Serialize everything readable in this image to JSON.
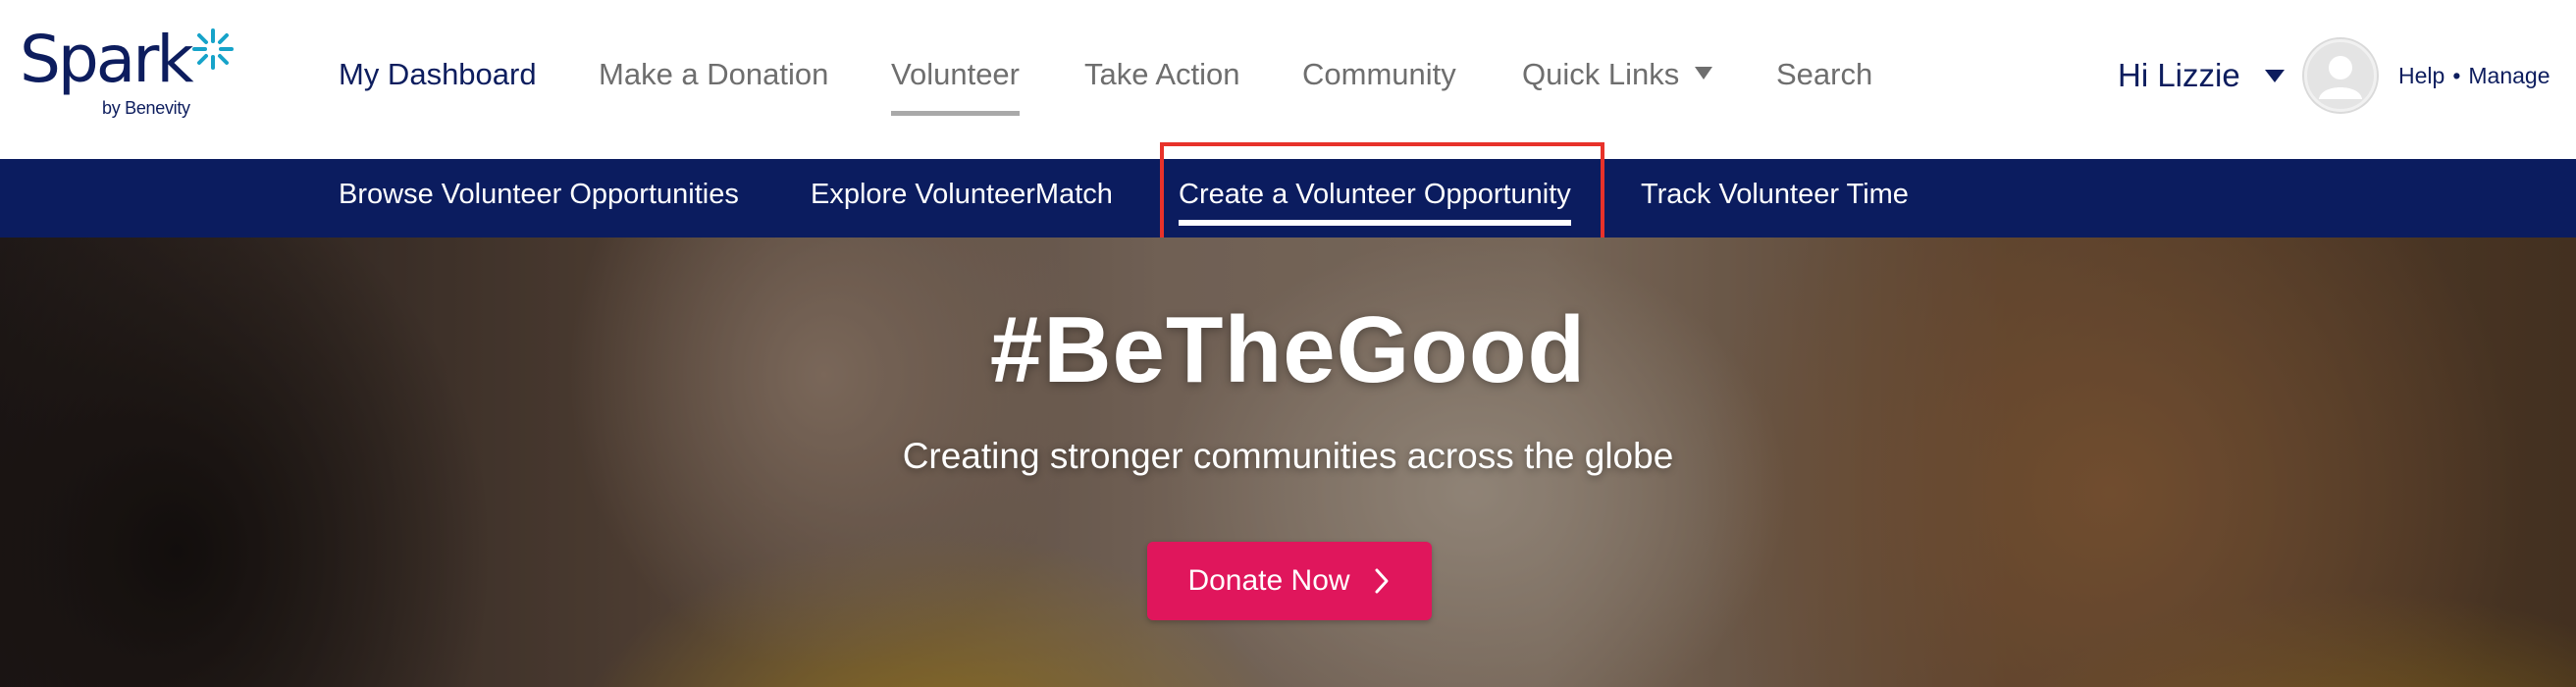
{
  "header": {
    "logo": {
      "word": "Spark",
      "sub": "by Benevity"
    },
    "nav": [
      {
        "label": "My Dashboard"
      },
      {
        "label": "Make a Donation"
      },
      {
        "label": "Volunteer"
      },
      {
        "label": "Take Action"
      },
      {
        "label": "Community"
      },
      {
        "label": "Quick Links"
      },
      {
        "label": "Search"
      }
    ],
    "active_nav": "Volunteer",
    "user": {
      "greeting": "Hi Lizzie",
      "help": "Help",
      "separator": "•",
      "manage": "Manage"
    }
  },
  "subnav": {
    "items": [
      {
        "label": "Browse Volunteer Opportunities"
      },
      {
        "label": "Explore VolunteerMatch"
      },
      {
        "label": "Create a Volunteer Opportunity"
      },
      {
        "label": "Track Volunteer Time"
      }
    ],
    "active": "Create a Volunteer Opportunity"
  },
  "hero": {
    "title": "#BeTheGood",
    "subtitle": "Creating stronger communities across the globe",
    "cta_label": "Donate Now"
  },
  "colors": {
    "navy": "#0b1c5f",
    "brand_text": "#0d1d5e",
    "accent_pink": "#e0165c",
    "highlight_red": "#e8322a",
    "logo_star": "#16a3c9"
  },
  "icons": [
    "spark-star-icon",
    "caret-down-icon",
    "user-avatar-icon",
    "chevron-right-icon"
  ]
}
